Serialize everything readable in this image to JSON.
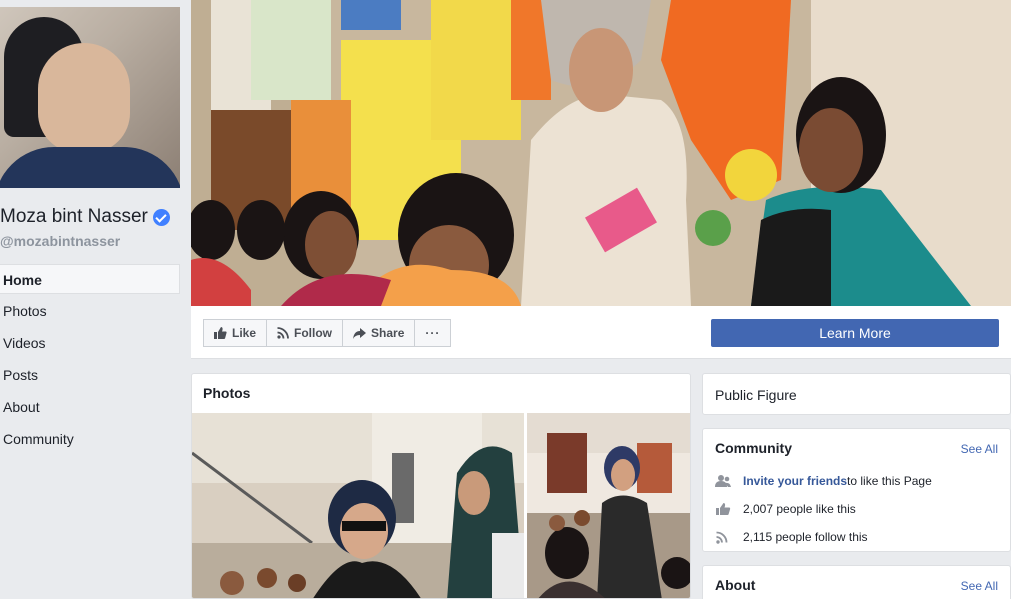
{
  "profile": {
    "name": "Moza bint Nasser",
    "handle": "@mozabintnasser"
  },
  "nav": {
    "items": [
      {
        "label": "Home",
        "active": true
      },
      {
        "label": "Photos"
      },
      {
        "label": "Videos"
      },
      {
        "label": "Posts"
      },
      {
        "label": "About"
      },
      {
        "label": "Community"
      }
    ]
  },
  "actions": {
    "like": "Like",
    "follow": "Follow",
    "share": "Share",
    "more": "···",
    "learn_more": "Learn More"
  },
  "photos": {
    "title": "Photos"
  },
  "category": {
    "label": "Public Figure"
  },
  "community": {
    "title": "Community",
    "see_all": "See All",
    "invite_link": "Invite your friends",
    "invite_rest": " to like this Page",
    "likes": "2,007 people like this",
    "follows": "2,115 people follow this"
  },
  "about": {
    "title": "About",
    "see_all": "See All"
  },
  "colors": {
    "accent": "#4267b2",
    "link": "#365899",
    "background": "#e9ebee",
    "verified": "#4080ff"
  },
  "icons": [
    "verified-badge-icon",
    "like-thumb-icon",
    "follow-rss-icon",
    "share-arrow-icon",
    "more-dots-icon",
    "friends-icon",
    "thumb-icon",
    "rss-icon"
  ]
}
